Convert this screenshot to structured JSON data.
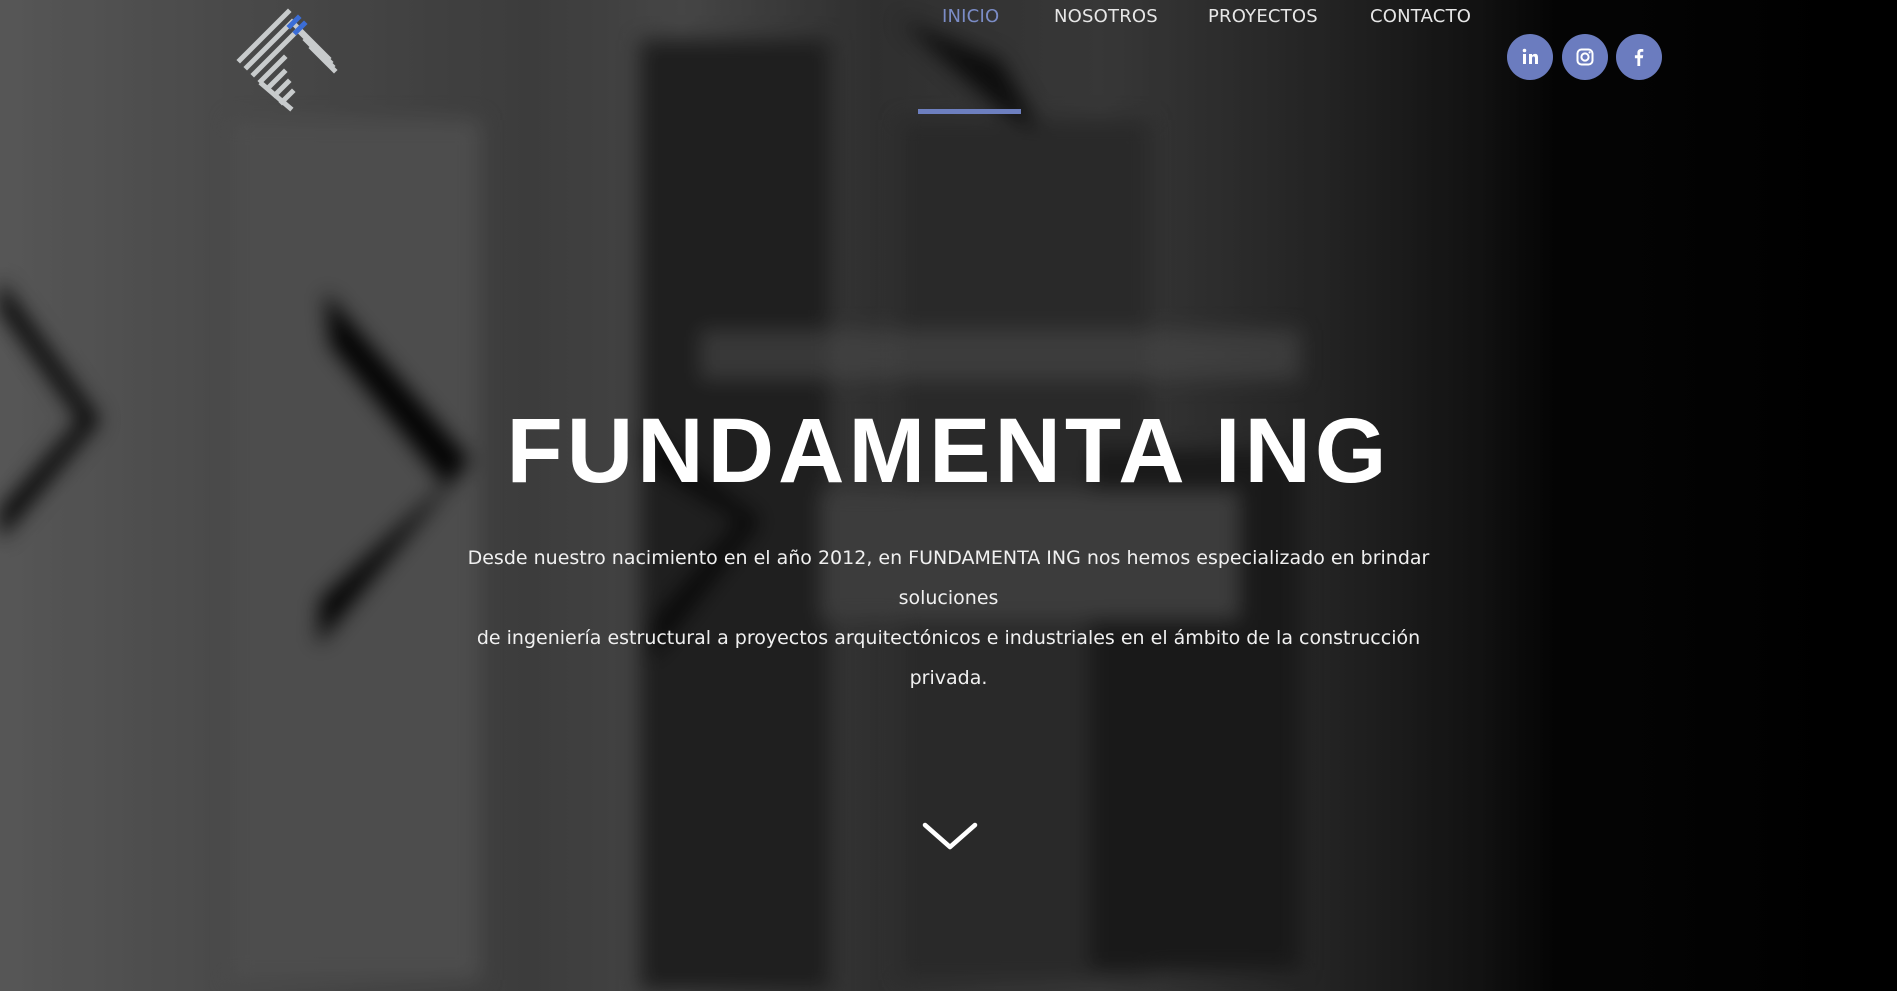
{
  "header": {
    "nav": [
      {
        "label": "INICIO",
        "active": true
      },
      {
        "label": "NOSOTROS",
        "active": false
      },
      {
        "label": "PROYECTOS",
        "active": false
      },
      {
        "label": "CONTACTO",
        "active": false
      }
    ],
    "social": [
      {
        "icon": "linkedin-icon",
        "glyph": "in"
      },
      {
        "icon": "instagram-icon",
        "glyph": "instagram"
      },
      {
        "icon": "facebook-icon",
        "glyph": "f"
      }
    ]
  },
  "hero": {
    "title": "FUNDAMENTA ING",
    "description_line1": "Desde nuestro nacimiento en el año 2012, en FUNDAMENTA ING nos hemos especializado en brindar soluciones",
    "description_line2": "de ingeniería estructural a proyectos arquitectónicos e industriales en el ámbito de la construcción privada.",
    "scroll_icon": "chevron-down-icon"
  },
  "colors": {
    "accent": "#6b7cbf",
    "active_nav": "#7b8cc6",
    "text": "#ffffff"
  }
}
